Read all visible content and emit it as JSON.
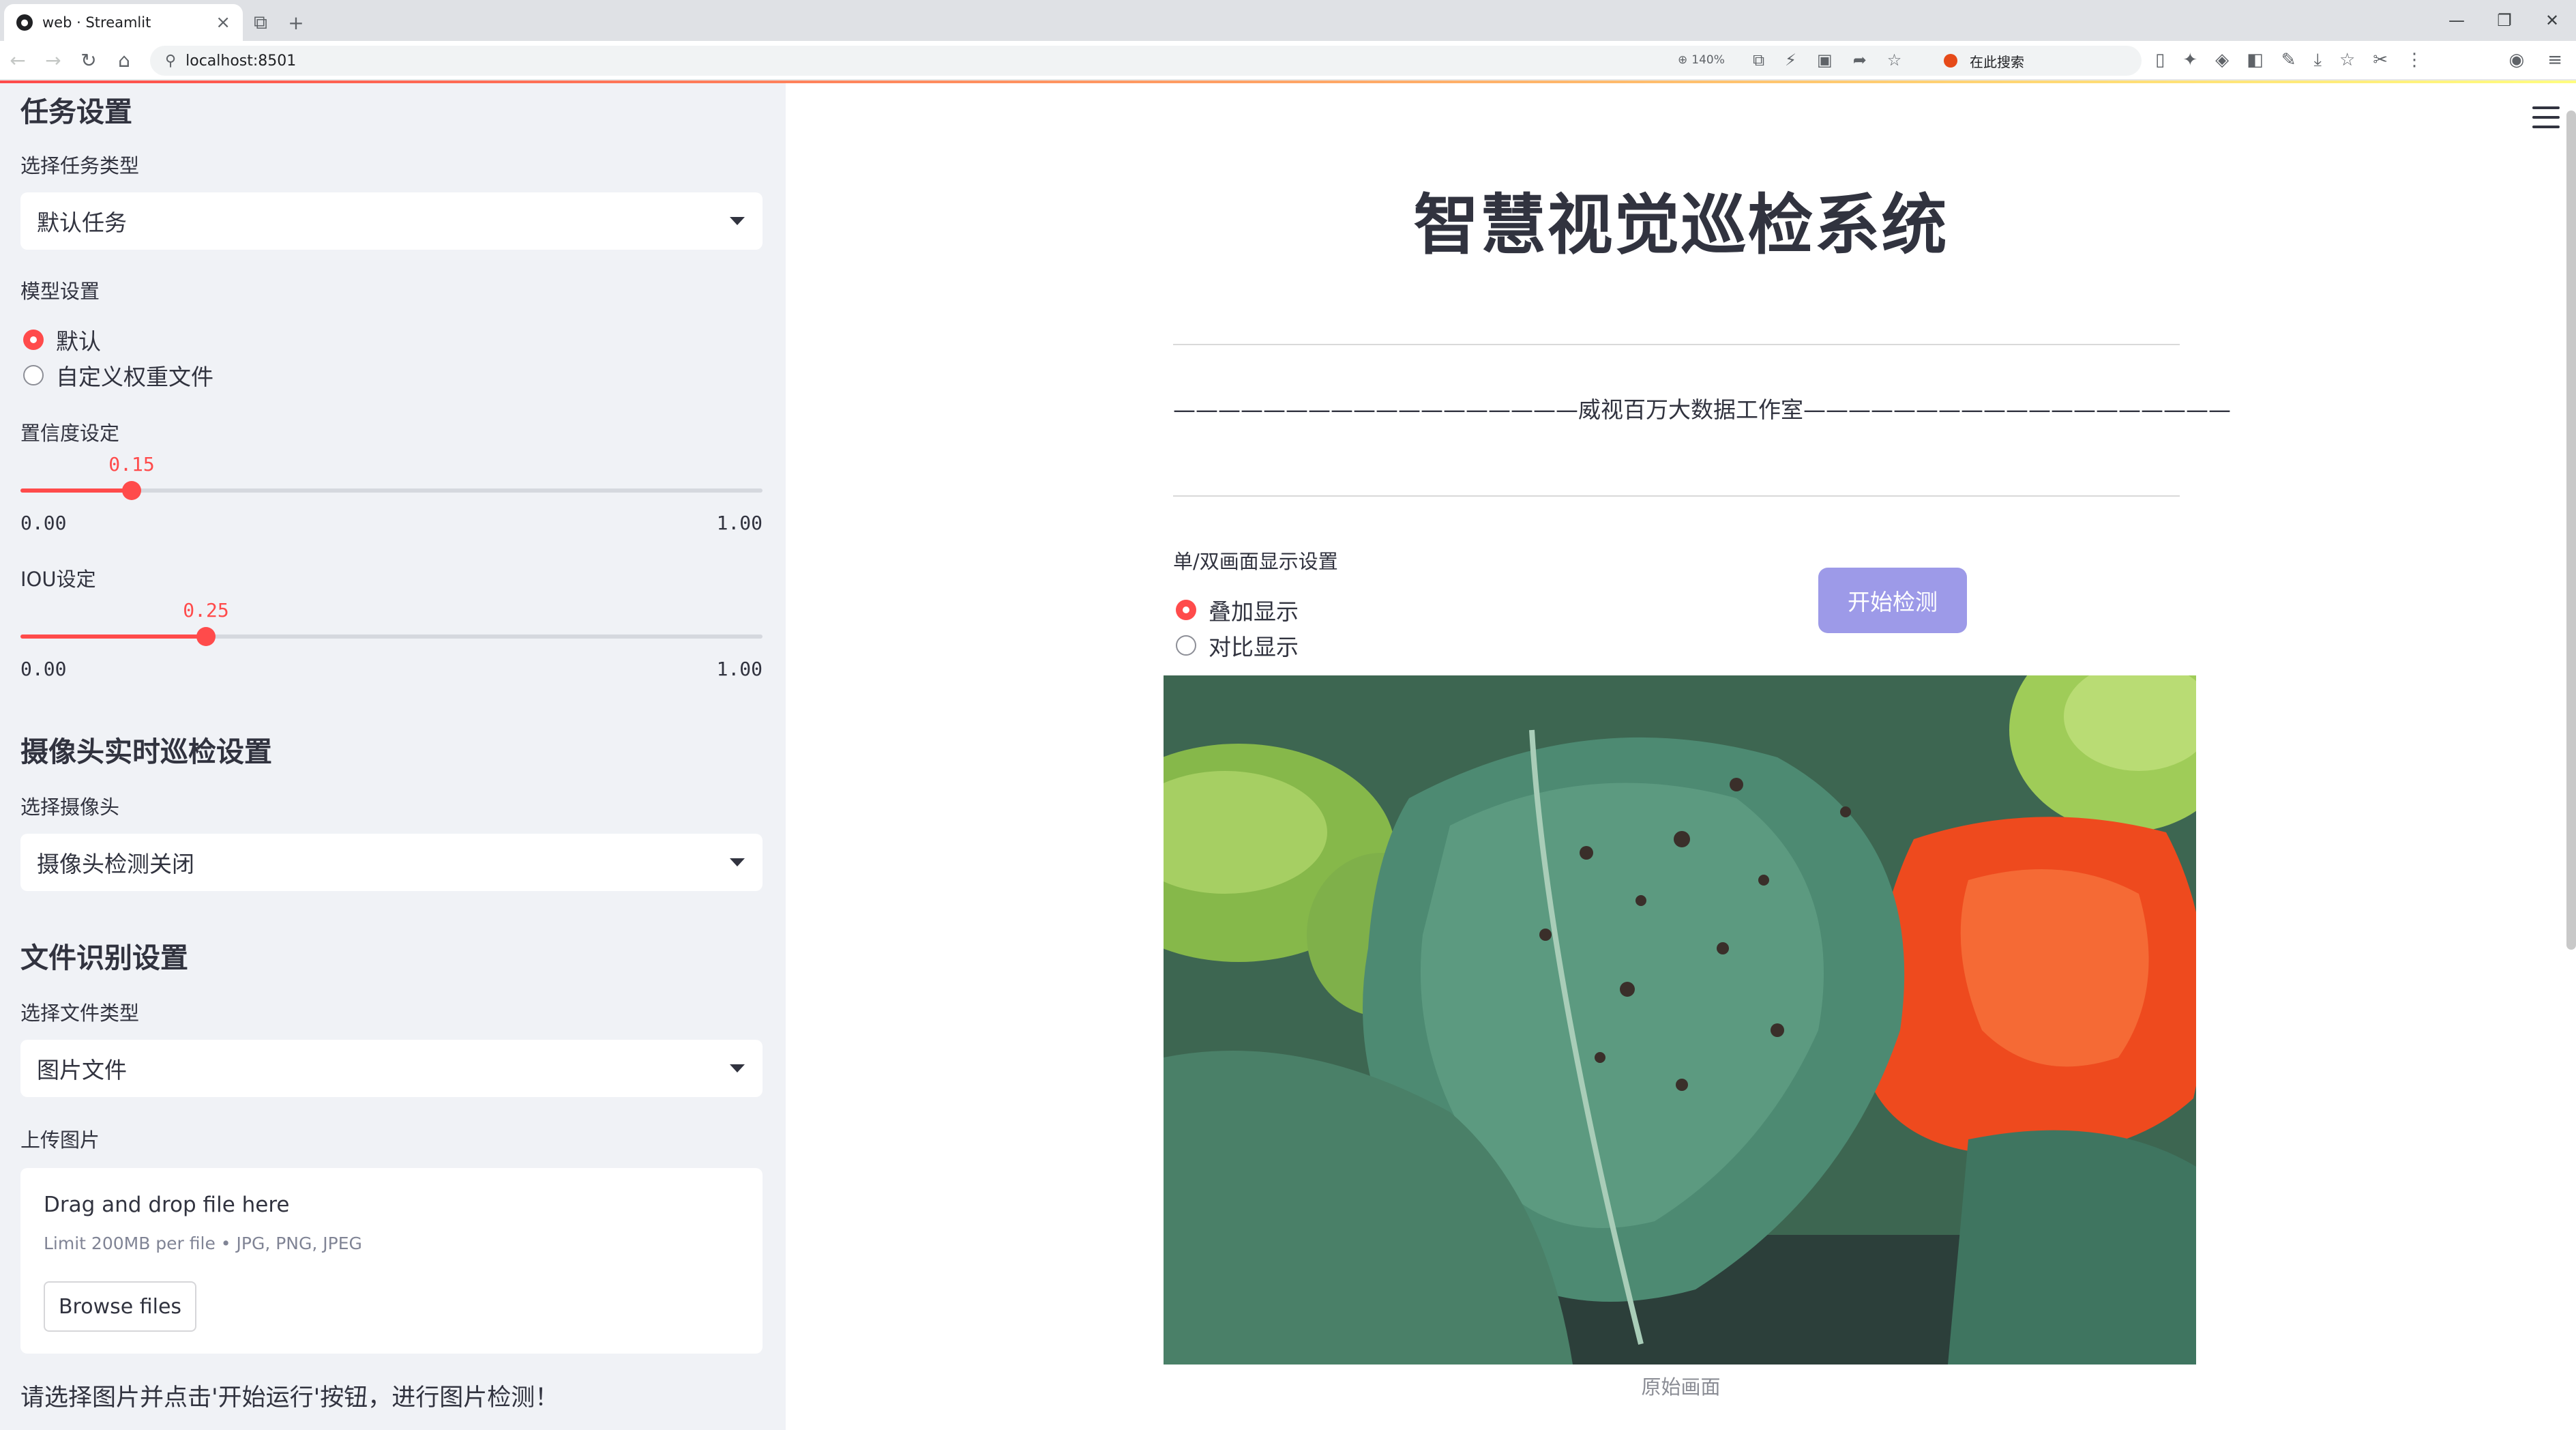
{
  "browser": {
    "tab_title": "web · Streamlit",
    "tab_close": "×",
    "tab_new": "+",
    "url": "localhost:8501",
    "zoom": "140%",
    "search_placeholder": "在此搜索",
    "window": {
      "minimize": "—",
      "restore": "❐",
      "close": "✕"
    }
  },
  "sidebar": {
    "task_section": "任务设置",
    "task_type_label": "选择任务类型",
    "task_type_value": "默认任务",
    "model_label": "模型设置",
    "model_options": [
      "默认",
      "自定义权重文件"
    ],
    "model_selected": "默认",
    "conf_label": "置信度设定",
    "conf": {
      "value": "0.15",
      "min": "0.00",
      "max": "1.00",
      "fraction": 0.15
    },
    "iou_label": "IOU设定",
    "iou": {
      "value": "0.25",
      "min": "0.00",
      "max": "1.00",
      "fraction": 0.25
    },
    "camera_section": "摄像头实时巡检设置",
    "camera_label": "选择摄像头",
    "camera_value": "摄像头检测关闭",
    "file_section": "文件识别设置",
    "file_type_label": "选择文件类型",
    "file_type_value": "图片文件",
    "upload_label": "上传图片",
    "upload": {
      "title": "Drag and drop file here",
      "limit": "Limit 200MB per file • JPG, PNG, JPEG",
      "button": "Browse files"
    },
    "hint": "请选择图片并点击'开始运行'按钮，进行图片检测！"
  },
  "main": {
    "title": "智慧视觉巡检系统",
    "subtitle": "——————————————————威视百万大数据工作室———————————————————",
    "display_label": "单/双画面显示设置",
    "display_options": [
      "叠加显示",
      "对比显示"
    ],
    "display_selected": "叠加显示",
    "start_button": "开始检测",
    "caption": "原始画面"
  },
  "colors": {
    "accent": "#ff4b4b",
    "sidebar_bg": "#f0f2f6",
    "start_button": "#9d9ae8"
  }
}
